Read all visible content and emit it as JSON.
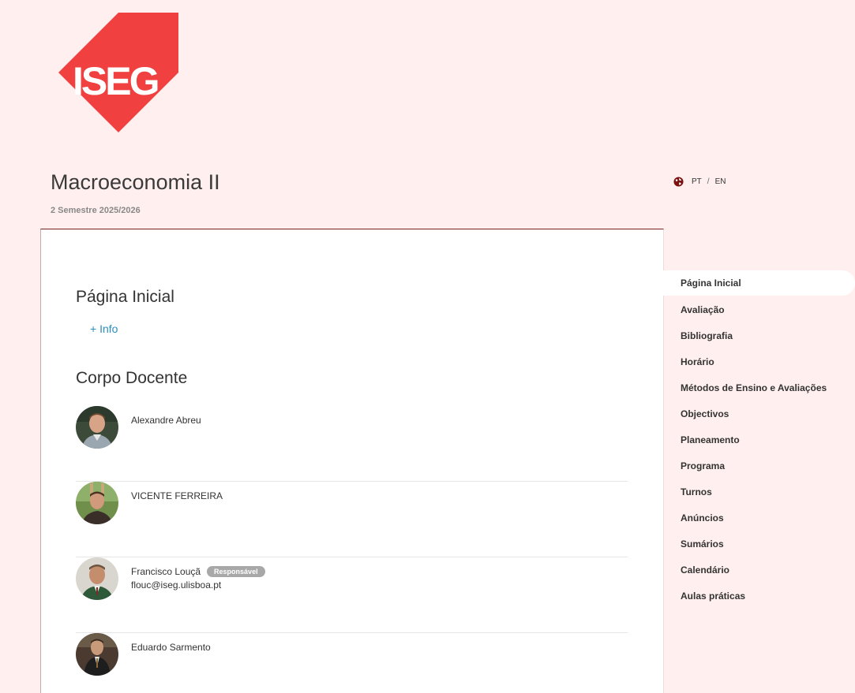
{
  "logo": {
    "text": "ISEG",
    "color": "#f0403f"
  },
  "course": {
    "title": "Macroeconomia II",
    "semester": "2 Semestre 2025/2026"
  },
  "language": {
    "pt": "PT",
    "separator": "/",
    "en": "EN",
    "icon": "globe-icon"
  },
  "home": {
    "title": "Página Inicial",
    "info_link": "+ Info"
  },
  "staff": {
    "title": "Corpo Docente",
    "members": [
      {
        "name": "Alexandre Abreu",
        "email": "",
        "badge": ""
      },
      {
        "name": "VICENTE FERREIRA",
        "email": "",
        "badge": ""
      },
      {
        "name": "Francisco Louçã",
        "email": "flouc@iseg.ulisboa.pt",
        "badge": "Responsável"
      },
      {
        "name": "Eduardo Sarmento",
        "email": "",
        "badge": ""
      }
    ]
  },
  "nav": {
    "items": [
      "Página Inicial",
      "Avaliação",
      "Bibliografia",
      "Horário",
      "Métodos de Ensino e Avaliações",
      "Objectivos",
      "Planeamento",
      "Programa",
      "Turnos",
      "Anúncios",
      "Sumários",
      "Calendário",
      "Aulas práticas"
    ]
  }
}
